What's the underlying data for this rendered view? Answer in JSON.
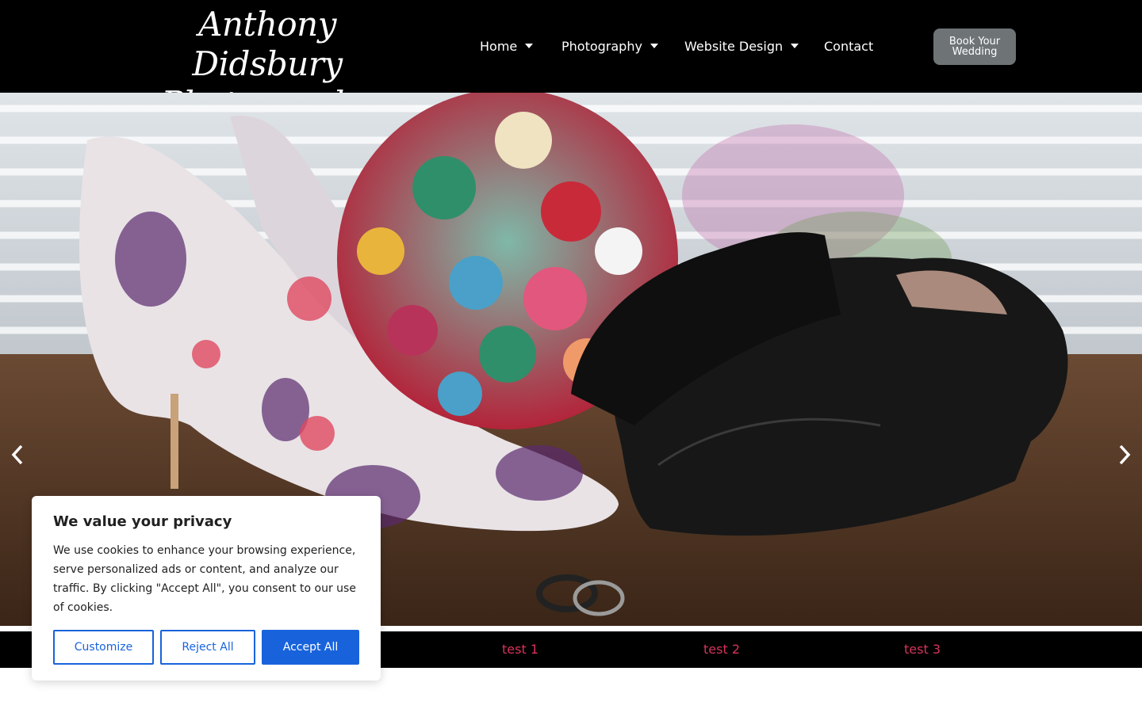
{
  "header": {
    "logo_line1": "Anthony Didsbury",
    "logo_line2": "Photography",
    "nav": [
      {
        "label": "Home"
      },
      {
        "label": "Photography"
      },
      {
        "label": "Website Design"
      },
      {
        "label": "Contact"
      }
    ],
    "book_line1": "Book Your",
    "book_line2": "Wedding"
  },
  "hero": {
    "prev_icon": "chevron-left-icon",
    "next_icon": "chevron-right-icon"
  },
  "strip": {
    "links": [
      "test 1",
      "test 2",
      "test 3"
    ]
  },
  "cookie": {
    "title": "We value your privacy",
    "body": "We use cookies to enhance your browsing experience, serve personalized ads or content, and analyze our traffic. By clicking \"Accept All\", you consent to our use of cookies.",
    "customize": "Customize",
    "reject": "Reject All",
    "accept": "Accept All"
  },
  "colors": {
    "header_bg": "#000000",
    "button_grey": "#6e7376",
    "link_pink": "#d6335b",
    "cookie_blue": "#1863dc"
  }
}
